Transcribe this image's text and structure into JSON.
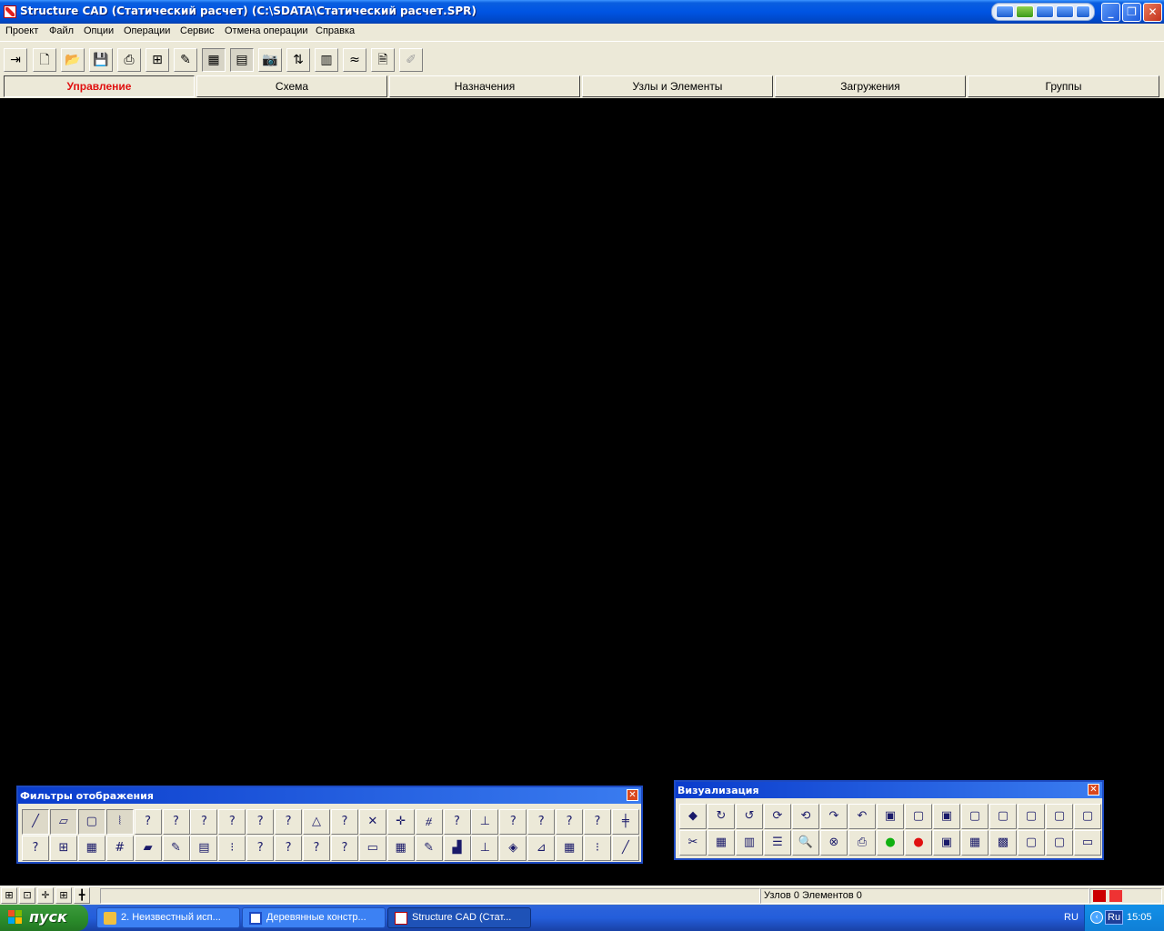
{
  "window": {
    "title": "Structure CAD (Статический расчет) (C:\\SDATA\\Статический расчет.SPR)",
    "controls": {
      "minimize": "_",
      "maximize": "❐",
      "close": "✕"
    }
  },
  "menu": [
    "Проект",
    "Файл",
    "Опции",
    "Операции",
    "Сервис",
    "Отмена операции",
    "Справка"
  ],
  "toolbar": {
    "icons": [
      "exit-icon",
      "new-icon",
      "open-icon",
      "save-icon",
      "print-icon",
      "tree-icon",
      "edit-icon",
      "grid-icon",
      "calc-icon",
      "camera-icon",
      "export-icon",
      "table-icon",
      "zigzag-icon",
      "doc-icon",
      "disabled-icon"
    ]
  },
  "tabs": [
    "Управление",
    "Схема",
    "Назначения",
    "Узлы и Элементы",
    "Загружения",
    "Группы"
  ],
  "active_tab": "Управление",
  "filters_panel": {
    "title": "Фильтры отображения",
    "close": "✕"
  },
  "visualization_panel": {
    "title": "Визуализация",
    "close": "✕"
  },
  "status": {
    "nodes_elements": "Узлов 0 Элементов 0"
  },
  "taskbar": {
    "start": "пуск",
    "tasks": [
      "2. Неизвестный исп...",
      "Деревянные констр...",
      "Structure CAD (Стат..."
    ],
    "lang1": "RU",
    "lang2": "Ru",
    "clock": "15:05"
  }
}
